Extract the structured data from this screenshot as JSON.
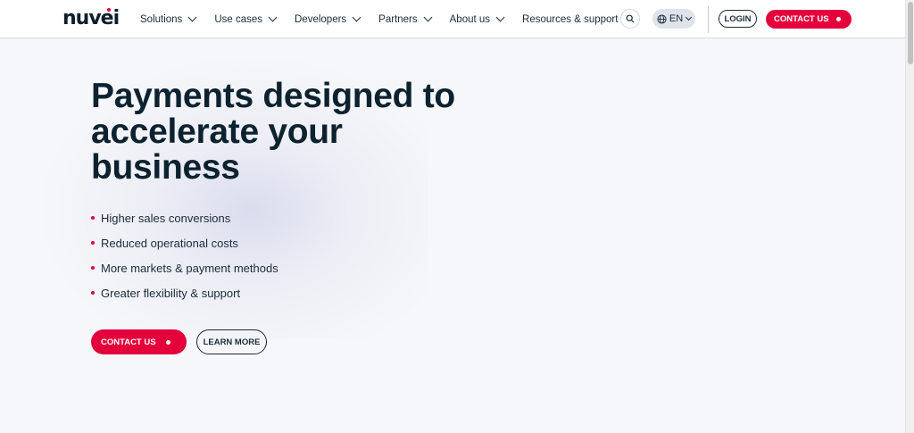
{
  "header": {
    "logo": "nuvei",
    "nav": [
      {
        "label": "Solutions"
      },
      {
        "label": "Use cases"
      },
      {
        "label": "Developers"
      },
      {
        "label": "Partners"
      },
      {
        "label": "About us"
      },
      {
        "label": "Resources & support"
      }
    ],
    "language": "EN",
    "login_label": "LOGIN",
    "contact_label": "CONTACT US"
  },
  "hero": {
    "title": "Payments designed to accelerate your business",
    "bullets": [
      "Higher sales conversions",
      "Reduced operational costs",
      "More markets & payment methods",
      "Greater flexibility & support"
    ],
    "contact_label": "CONTACT US",
    "learn_label": "LEARN MORE"
  },
  "colors": {
    "accent": "#e4003b",
    "text": "#1b2b3a",
    "background": "#f6f7fa"
  },
  "icons": {
    "search": "search-icon",
    "language": "globe-icon",
    "dropdown": "chevron-down-icon"
  }
}
